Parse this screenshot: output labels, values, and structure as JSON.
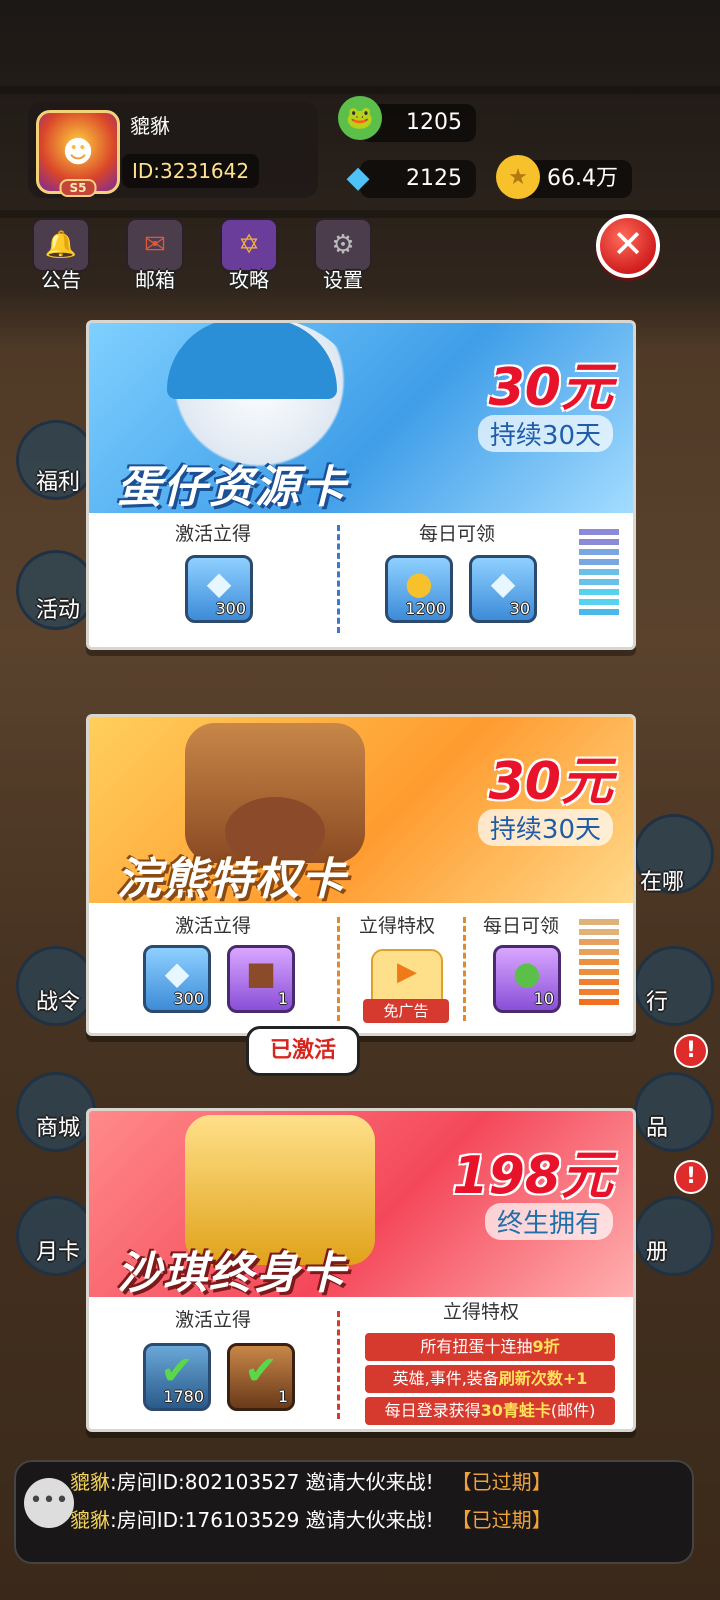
{
  "profile": {
    "name": "貔貅",
    "id": "ID:3231642",
    "level": "S5"
  },
  "currencies": {
    "frog": "1205",
    "diamond": "2125",
    "coin": "66.4万"
  },
  "top_buttons": [
    {
      "label": "公告"
    },
    {
      "label": "邮箱"
    },
    {
      "label": "攻略"
    },
    {
      "label": "设置"
    }
  ],
  "side_left": [
    "福利",
    "活动",
    "战令",
    "商城",
    "月卡"
  ],
  "side_right": [
    "在哪",
    "行",
    "品",
    "册"
  ],
  "cards": [
    {
      "title": "蛋仔资源卡",
      "price": "30元",
      "duration": "持续30天",
      "sections": {
        "activate": "激活立得",
        "daily": "每日可领"
      },
      "activate_items": [
        {
          "qty": "300"
        }
      ],
      "daily_items": [
        {
          "qty": "1200"
        },
        {
          "qty": "30"
        }
      ]
    },
    {
      "title": "浣熊特权卡",
      "price": "30元",
      "duration": "持续30天",
      "sections": {
        "activate": "激活立得",
        "privilege": "立得特权",
        "daily": "每日可领"
      },
      "activate_items": [
        {
          "qty": "300"
        },
        {
          "qty": "1"
        }
      ],
      "privilege_item": {
        "label": "免广告"
      },
      "daily_items": [
        {
          "qty": "10"
        }
      ]
    },
    {
      "title": "沙琪终身卡",
      "price": "198元",
      "duration": "终生拥有",
      "status": "已激活",
      "sections": {
        "activate": "激活立得",
        "privilege": "立得特权"
      },
      "activate_items": [
        {
          "qty": "1780"
        },
        {
          "qty": "1"
        }
      ],
      "privileges": [
        {
          "pre": "所有扭蛋十连抽",
          "hl": "9折",
          "post": ""
        },
        {
          "pre": "英雄,事件,装备",
          "hl": "刷新次数+1",
          "post": ""
        },
        {
          "pre": "每日登录获得",
          "hl": "30青蛙卡",
          "post": "(邮件)"
        }
      ]
    }
  ],
  "chat": [
    {
      "name": "貔貅",
      "text": ":房间ID:802103527 邀请大伙来战!",
      "status": "【已过期】"
    },
    {
      "name": "貔貅",
      "text": ":房间ID:176103529 邀请大伙来战!",
      "status": "【已过期】"
    }
  ]
}
